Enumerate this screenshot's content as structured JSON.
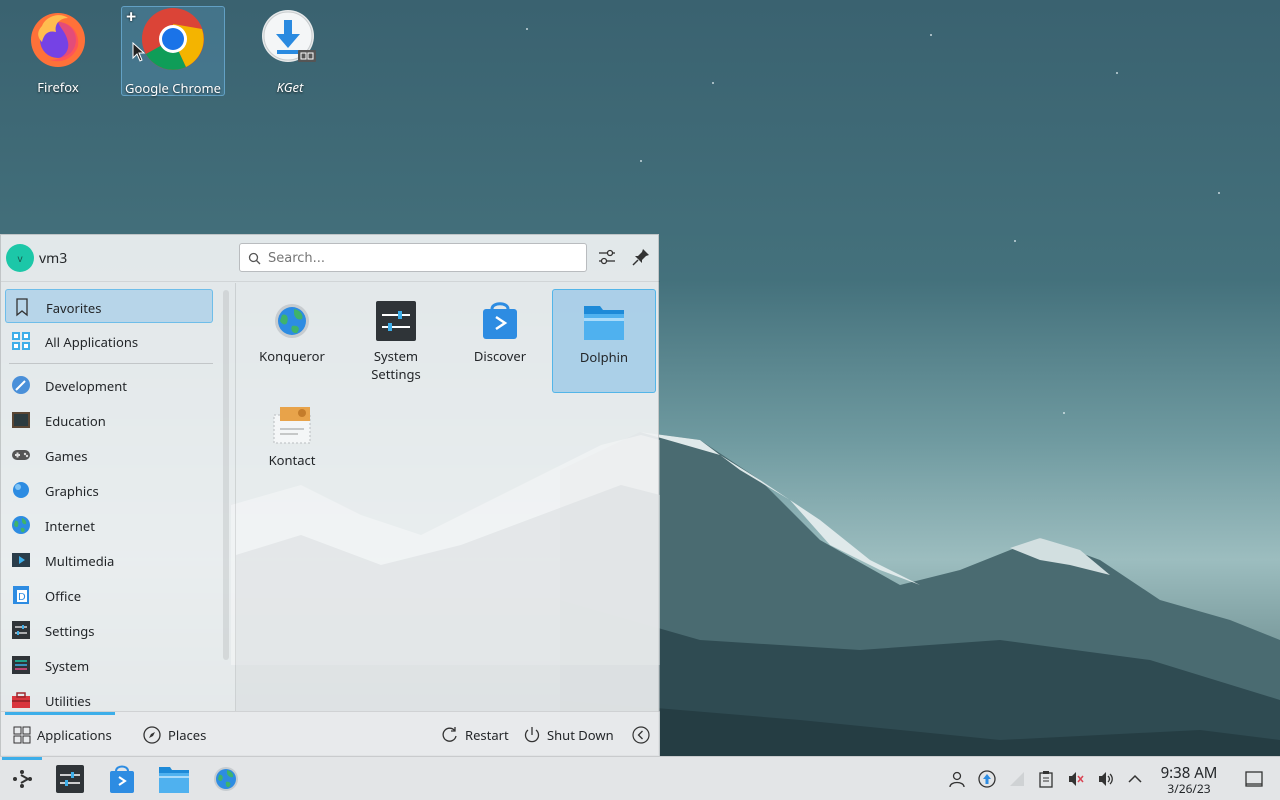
{
  "desktop": {
    "icons": [
      {
        "label": "Firefox",
        "icon": "firefox-icon"
      },
      {
        "label": "Google Chrome",
        "icon": "chrome-icon",
        "selected": true
      },
      {
        "label": "KGet",
        "icon": "kget-icon"
      }
    ]
  },
  "launcher": {
    "user": {
      "avatar_letter": "v",
      "name": "vm3"
    },
    "search": {
      "placeholder": "Search..."
    },
    "header_buttons": [
      "configure-icon",
      "pin-icon"
    ],
    "categories": [
      {
        "label": "Favorites",
        "icon": "bookmark-icon",
        "active": true
      },
      {
        "label": "All Applications",
        "icon": "grid-icon"
      },
      {
        "label": "Development",
        "icon": "development-icon"
      },
      {
        "label": "Education",
        "icon": "education-icon"
      },
      {
        "label": "Games",
        "icon": "gamepad-icon"
      },
      {
        "label": "Graphics",
        "icon": "graphics-icon"
      },
      {
        "label": "Internet",
        "icon": "globe-icon"
      },
      {
        "label": "Multimedia",
        "icon": "multimedia-icon"
      },
      {
        "label": "Office",
        "icon": "office-icon"
      },
      {
        "label": "Settings",
        "icon": "settings-icon"
      },
      {
        "label": "System",
        "icon": "system-icon"
      },
      {
        "label": "Utilities",
        "icon": "toolbox-icon"
      }
    ],
    "apps": [
      {
        "label": "Konqueror",
        "icon": "konqueror-icon"
      },
      {
        "label": "System\nSettings",
        "label_line1": "System",
        "label_line2": "Settings",
        "icon": "system-settings-icon"
      },
      {
        "label": "Discover",
        "icon": "discover-icon"
      },
      {
        "label": "Dolphin",
        "icon": "folder-icon",
        "active": true
      },
      {
        "label": "Kontact",
        "icon": "kontact-icon"
      }
    ],
    "footer": {
      "applications": "Applications",
      "places": "Places",
      "restart": "Restart",
      "shutdown": "Shut Down"
    }
  },
  "taskbar": {
    "launcher_icon": "kde-launcher-icon",
    "tasks": [
      "system-settings-icon",
      "discover-icon",
      "folder-icon",
      "konqueror-icon"
    ],
    "tray": [
      "user-icon",
      "update-icon",
      "network-icon",
      "clipboard-icon",
      "mute-icon",
      "volume-icon",
      "chevron-up-icon"
    ],
    "time": "9:38 AM",
    "date": "3/26/23",
    "show_desktop_icon": "show-desktop-icon"
  },
  "colors": {
    "accent": "#3daee9",
    "selection": "#93c4e7"
  }
}
